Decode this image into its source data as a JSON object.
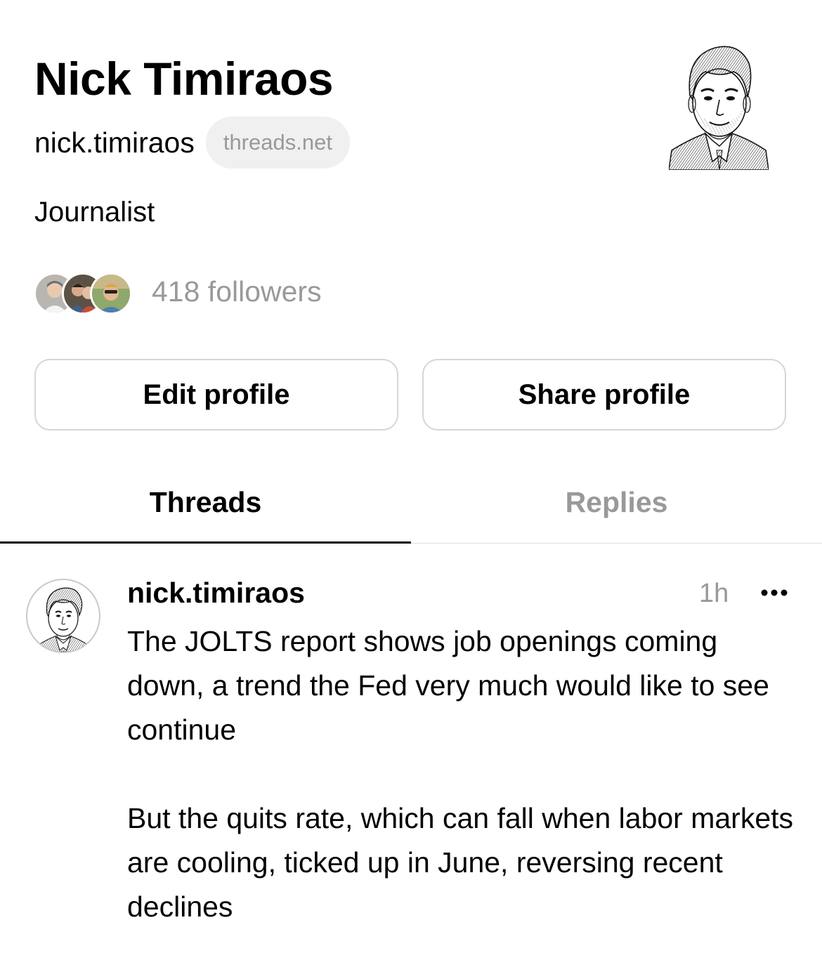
{
  "profile": {
    "name": "Nick Timiraos",
    "handle": "nick.timiraos",
    "domain_badge": "threads.net",
    "bio": "Journalist",
    "followers": "418 followers"
  },
  "actions": {
    "edit_label": "Edit profile",
    "share_label": "Share profile"
  },
  "tabs": [
    {
      "label": "Threads",
      "active": true
    },
    {
      "label": "Replies",
      "active": false
    }
  ],
  "post": {
    "author": "nick.timiraos",
    "time": "1h",
    "paragraphs": [
      "The JOLTS report shows job openings coming down, a trend the Fed very much would like to see continue",
      "But the quits rate, which can fall when labor markets are cooling, ticked up in June, reversing recent declines"
    ]
  },
  "icons": [
    "portrait-avatar",
    "more-options-icon"
  ]
}
